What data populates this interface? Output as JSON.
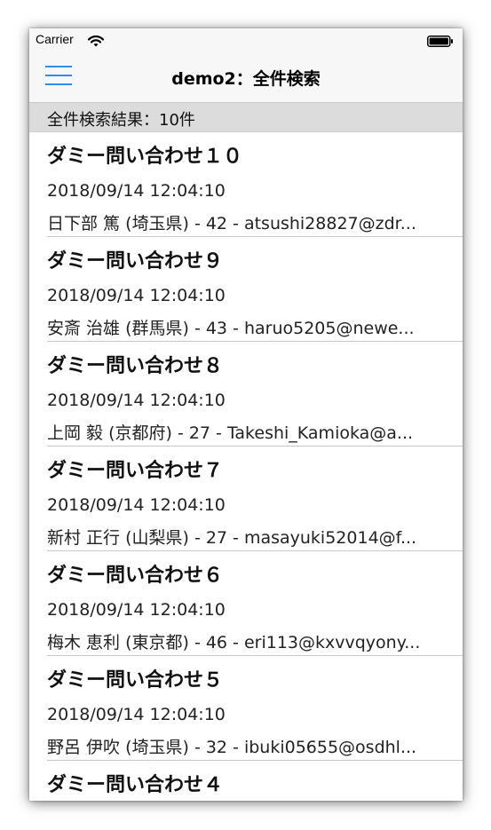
{
  "status_bar": {
    "carrier": "Carrier"
  },
  "nav": {
    "title": "demo2：全件検索",
    "accent_color": "#2f8df0"
  },
  "section": {
    "header": "全件検索結果：10件"
  },
  "results": [
    {
      "title": "ダミー問い合わせ１０",
      "date": "2018/09/14 12:04:10",
      "detail": "日下部 篤 (埼玉県) - 42 - atsushi28827@zdr..."
    },
    {
      "title": "ダミー問い合わせ９",
      "date": "2018/09/14 12:04:10",
      "detail": "安斎 治雄 (群馬県) - 43 - haruo5205@newe..."
    },
    {
      "title": "ダミー問い合わせ８",
      "date": "2018/09/14 12:04:10",
      "detail": "上岡 毅 (京都府) - 27 - Takeshi_Kamioka@a..."
    },
    {
      "title": "ダミー問い合わせ７",
      "date": "2018/09/14 12:04:10",
      "detail": "新村 正行 (山梨県) - 27 - masayuki52014@f..."
    },
    {
      "title": "ダミー問い合わせ６",
      "date": "2018/09/14 12:04:10",
      "detail": "梅木 恵利 (東京都) - 46 - eri113@kxvvqyony..."
    },
    {
      "title": "ダミー問い合わせ５",
      "date": "2018/09/14 12:04:10",
      "detail": "野呂 伊吹 (埼玉県) - 32 - ibuki05655@osdhl..."
    },
    {
      "title": "ダミー問い合わせ４"
    }
  ]
}
